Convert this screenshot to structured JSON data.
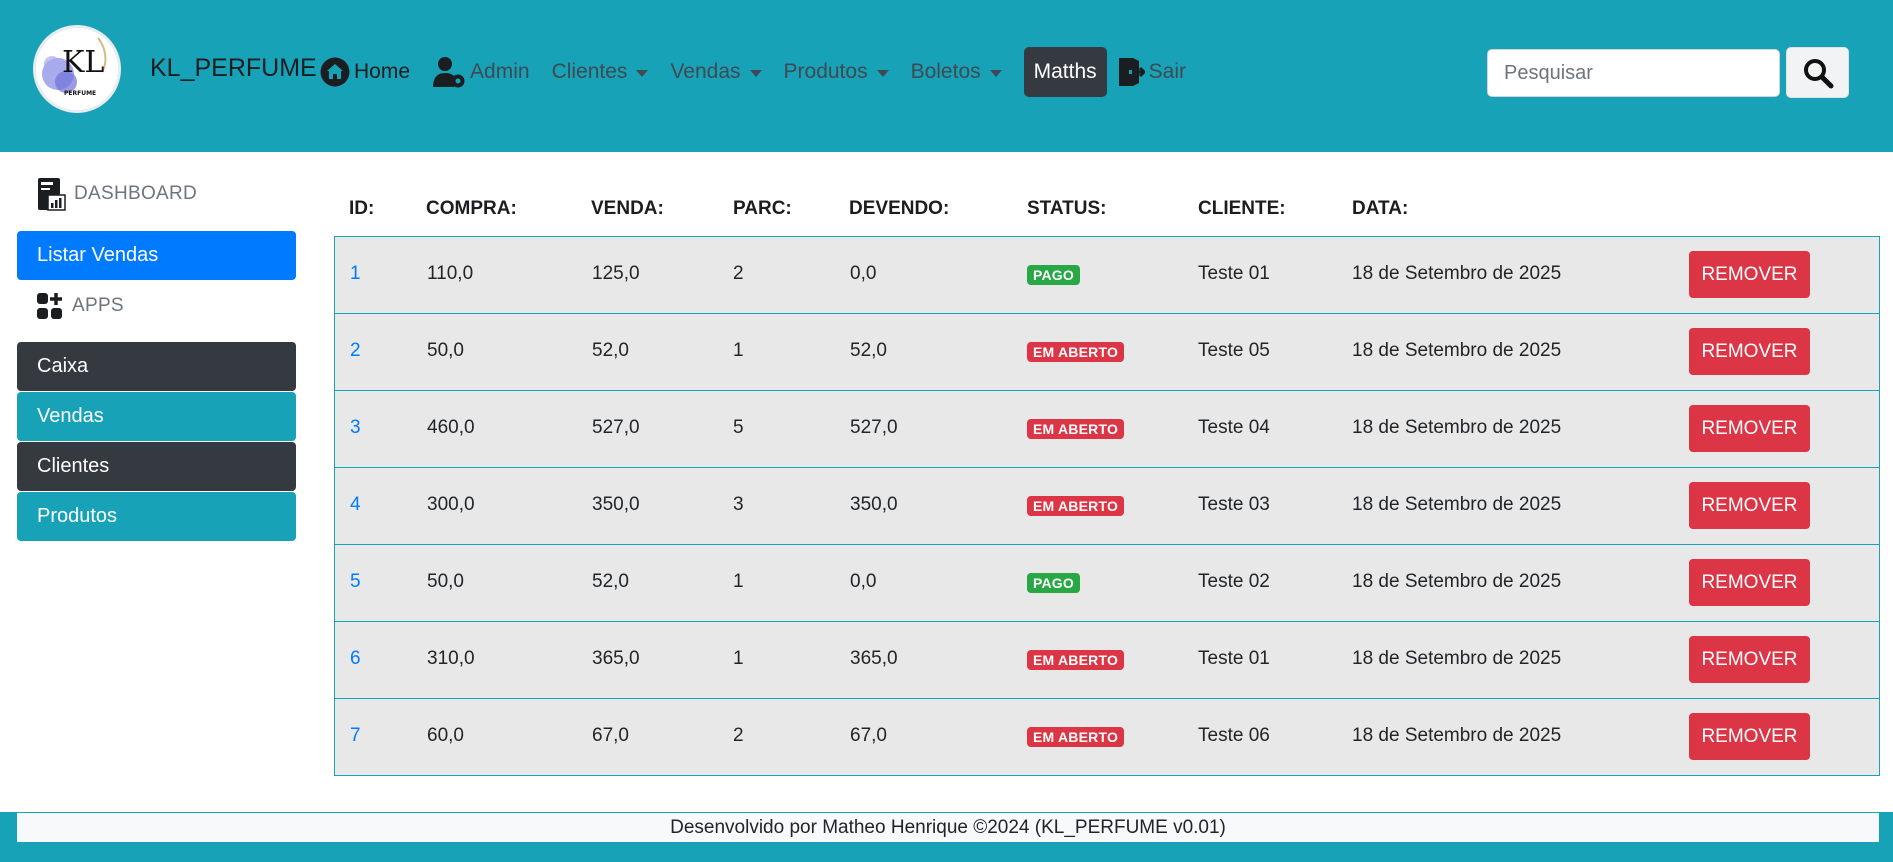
{
  "navbar": {
    "brand": "KL_PERFUME",
    "logo_text": "KL",
    "logo_subtext": "PERFUME",
    "items": [
      {
        "label": "Home",
        "icon": "home-icon"
      },
      {
        "label": "Admin",
        "icon": "user-gear-icon"
      },
      {
        "label": "Clientes",
        "dropdown": true
      },
      {
        "label": "Vendas",
        "dropdown": true
      },
      {
        "label": "Produtos",
        "dropdown": true
      },
      {
        "label": "Boletos",
        "dropdown": true
      },
      {
        "label": "Matths",
        "active": true
      },
      {
        "label": "Sair",
        "icon": "door-exit-icon"
      }
    ],
    "search_placeholder": "Pesquisar"
  },
  "sidebar": {
    "dashboard_label": "DASHBOARD",
    "list_button": "Listar Vendas",
    "apps_label": "APPS",
    "items": [
      "Caixa",
      "Vendas",
      "Clientes",
      "Produtos"
    ]
  },
  "table": {
    "headers": [
      "ID:",
      "COMPRA:",
      "VENDA:",
      "PARC:",
      "DEVENDO:",
      "STATUS:",
      "CLIENTE:",
      "DATA:"
    ],
    "remove_label": "REMOVER",
    "rows": [
      {
        "id": "1",
        "compra": "110,0",
        "venda": "125,0",
        "parc": "2",
        "devendo": "0,0",
        "status": "PAGO",
        "cliente": "Teste 01",
        "data": "18 de Setembro de 2025"
      },
      {
        "id": "2",
        "compra": "50,0",
        "venda": "52,0",
        "parc": "1",
        "devendo": "52,0",
        "status": "EM ABERTO",
        "cliente": "Teste 05",
        "data": "18 de Setembro de 2025"
      },
      {
        "id": "3",
        "compra": "460,0",
        "venda": "527,0",
        "parc": "5",
        "devendo": "527,0",
        "status": "EM ABERTO",
        "cliente": "Teste 04",
        "data": "18 de Setembro de 2025"
      },
      {
        "id": "4",
        "compra": "300,0",
        "venda": "350,0",
        "parc": "3",
        "devendo": "350,0",
        "status": "EM ABERTO",
        "cliente": "Teste 03",
        "data": "18 de Setembro de 2025"
      },
      {
        "id": "5",
        "compra": "50,0",
        "venda": "52,0",
        "parc": "1",
        "devendo": "0,0",
        "status": "PAGO",
        "cliente": "Teste 02",
        "data": "18 de Setembro de 2025"
      },
      {
        "id": "6",
        "compra": "310,0",
        "venda": "365,0",
        "parc": "1",
        "devendo": "365,0",
        "status": "EM ABERTO",
        "cliente": "Teste 01",
        "data": "18 de Setembro de 2025"
      },
      {
        "id": "7",
        "compra": "60,0",
        "venda": "67,0",
        "parc": "2",
        "devendo": "67,0",
        "status": "EM ABERTO",
        "cliente": "Teste 06",
        "data": "18 de Setembro de 2025"
      }
    ]
  },
  "footer": {
    "text": "Desenvolvido por Matheo Henrique ©2024 (KL_PERFUME v0.01)"
  },
  "colors": {
    "navbar": "#17a2b8",
    "primary": "#007bff",
    "dark": "#343a40",
    "danger": "#dc3545",
    "success": "#28a745"
  }
}
